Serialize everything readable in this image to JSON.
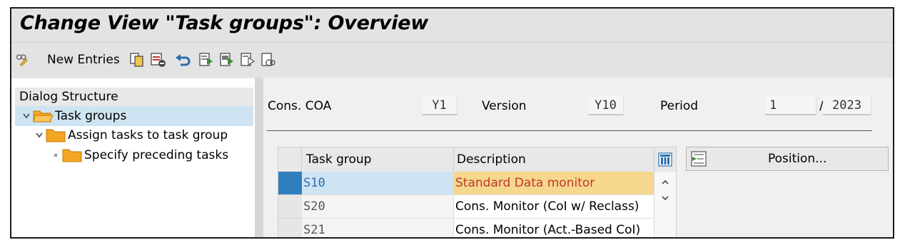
{
  "window": {
    "title": "Change View \"Task groups\": Overview"
  },
  "toolbar": {
    "new_entries_label": "New Entries",
    "icons": [
      "display-change-icon",
      "copy-icon",
      "delete-icon",
      "undo-icon",
      "select-all-icon",
      "select-block-icon",
      "deselect-all-icon",
      "configure-icon"
    ]
  },
  "dialog_structure": {
    "header": "Dialog Structure",
    "items": [
      {
        "label": "Task groups",
        "level": 0,
        "selected": true,
        "expanded": true
      },
      {
        "label": "Assign tasks to task group",
        "level": 1,
        "selected": false,
        "expanded": true
      },
      {
        "label": "Specify preceding tasks",
        "level": 2,
        "selected": false,
        "expanded": false
      }
    ]
  },
  "filters": {
    "cons_coa_label": "Cons. COA",
    "cons_coa_value": "Y1",
    "version_label": "Version",
    "version_value": "Y10",
    "period_label": "Period",
    "period_value": "1",
    "period_separator": "/",
    "year_value": "2023"
  },
  "table": {
    "columns": [
      "Task group",
      "Description"
    ],
    "rows": [
      {
        "task_group": "S10",
        "description": "Standard Data monitor",
        "selected": true
      },
      {
        "task_group": "S20",
        "description": "Cons. Monitor (CoI w/ Reclass)",
        "selected": false
      },
      {
        "task_group": "S21",
        "description": "Cons. Monitor (Act.-Based CoI)",
        "selected": false
      }
    ]
  },
  "position_button": {
    "label": "Position..."
  },
  "colors": {
    "title_bar": "#e3e3e3",
    "selection_blue": "#cfe4f2",
    "row_selector_active": "#2f7fbf",
    "highlight_cell": "#f5d78e",
    "highlight_text": "#c0392b",
    "folder_yellow": "#f5a623"
  }
}
